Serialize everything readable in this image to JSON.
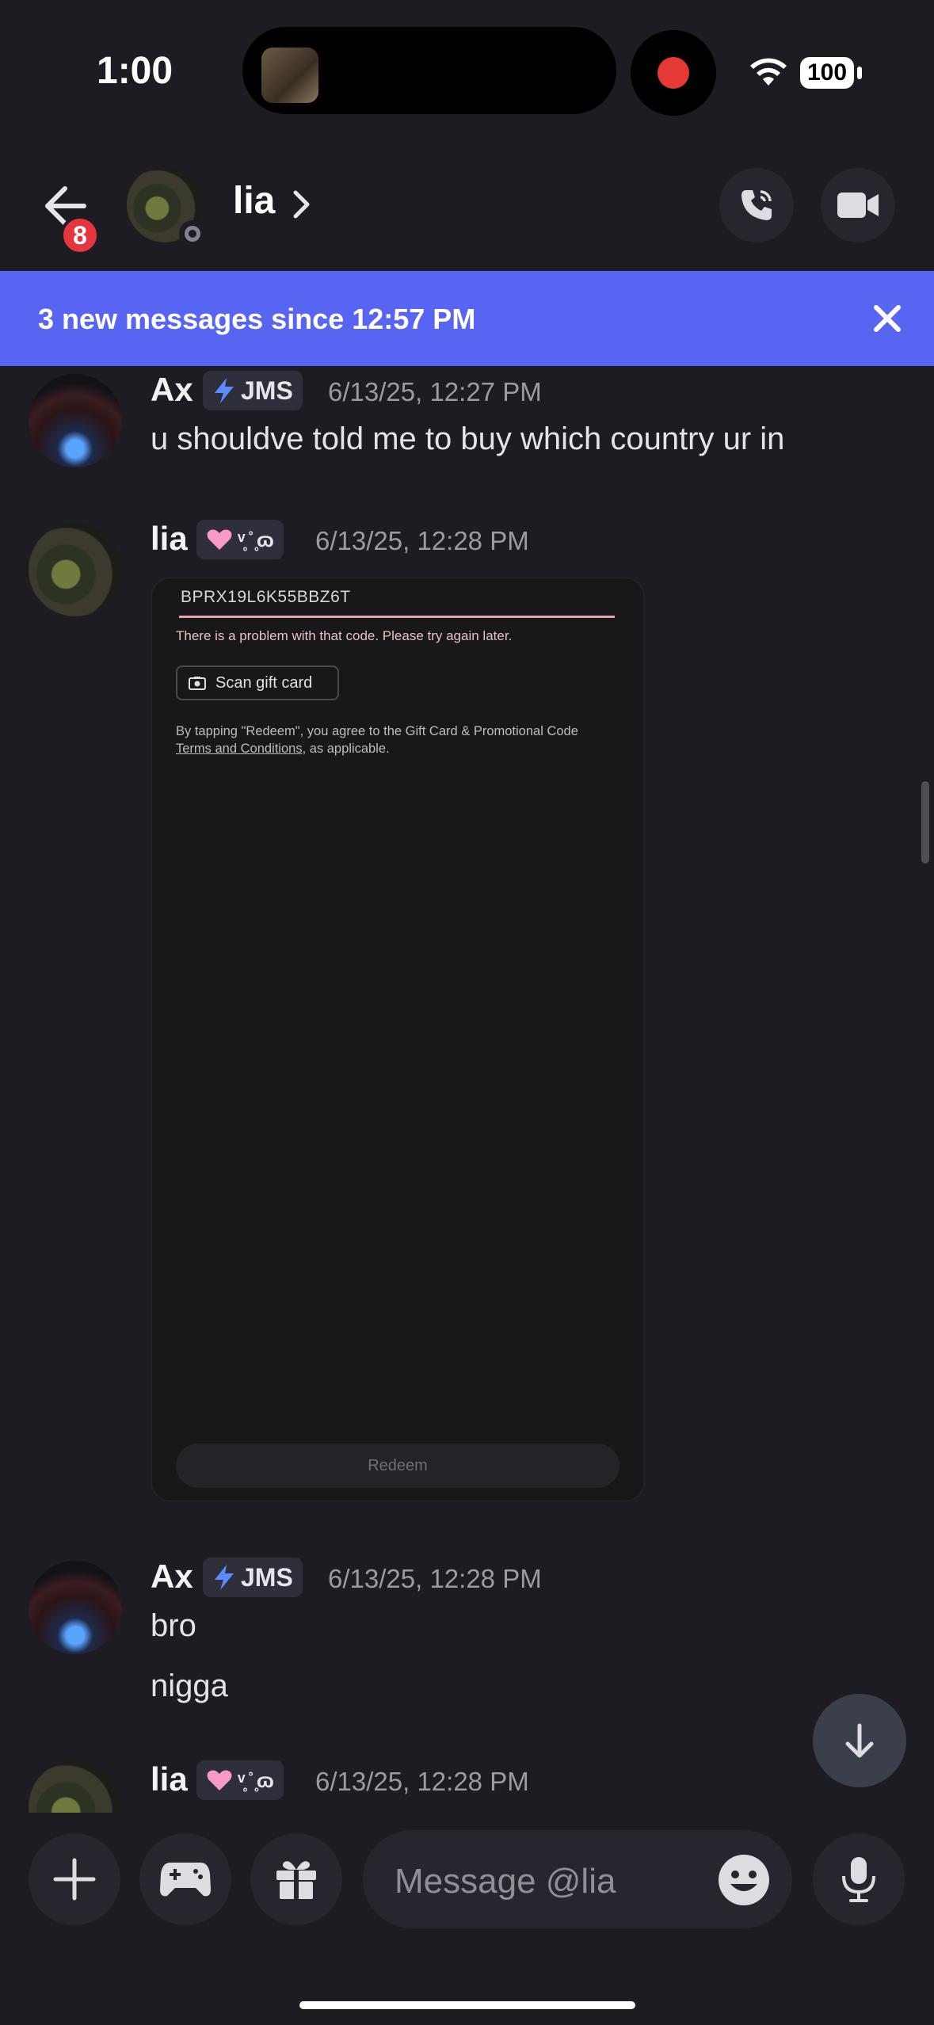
{
  "status_bar": {
    "time": "1:00",
    "battery": "100"
  },
  "header": {
    "unread_badge": "8",
    "contact_name": "lia"
  },
  "banner": {
    "text": "3 new messages since 12:57 PM"
  },
  "messages": [
    {
      "author": "Ax",
      "tag": "JMS",
      "timestamp": "6/13/25, 12:27 PM",
      "lines": [
        "u shouldve told me to buy which country ur in"
      ]
    },
    {
      "author": "lia",
      "tag": "ᵛ̥ ̊ ̥ɷ",
      "timestamp": "6/13/25, 12:28 PM",
      "attachment": {
        "code": "BPRX19L6K55BBZ6T",
        "error": "There is a problem with that code. Please try again later.",
        "scan_label": "Scan gift card",
        "terms_before": "By tapping \"Redeem\", you agree to the Gift Card & Promotional Code ",
        "terms_link": "Terms and Conditions",
        "terms_after": ", as applicable.",
        "redeem_label": "Redeem"
      }
    },
    {
      "author": "Ax",
      "tag": "JMS",
      "timestamp": "6/13/25, 12:28 PM",
      "lines": [
        "bro",
        "nigga"
      ]
    },
    {
      "author": "lia",
      "tag": "ᵛ̥ ̊ ̥ɷ",
      "timestamp": "6/13/25, 12:28 PM"
    }
  ],
  "composer": {
    "placeholder": "Message @lia"
  },
  "colors": {
    "blurple": "#5865f2",
    "background": "#1c1c22",
    "danger": "#e5353f"
  }
}
